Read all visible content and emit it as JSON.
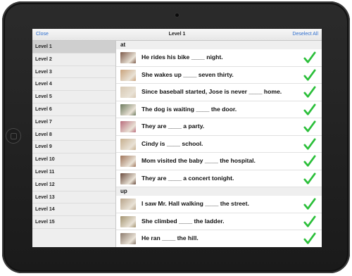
{
  "topbar": {
    "close_label": "Close",
    "title": "Level 1",
    "deselect_label": "Deselect All"
  },
  "sidebar": {
    "items": [
      {
        "label": "Level 1"
      },
      {
        "label": "Level 2"
      },
      {
        "label": "Level 3"
      },
      {
        "label": "Level 4"
      },
      {
        "label": "Level 5"
      },
      {
        "label": "Level 6"
      },
      {
        "label": "Level 7"
      },
      {
        "label": "Level 8"
      },
      {
        "label": "Level 9"
      },
      {
        "label": "Level 10"
      },
      {
        "label": "Level 11"
      },
      {
        "label": "Level 12"
      },
      {
        "label": "Level 13"
      },
      {
        "label": "Level 14"
      },
      {
        "label": "Level 15"
      }
    ],
    "active_index": 0
  },
  "sections": [
    {
      "header": "at",
      "rows": [
        {
          "text": "He rides his bike ____ night.",
          "checked": true
        },
        {
          "text": "She wakes up ____ seven thirty.",
          "checked": true
        },
        {
          "text": "Since baseball started, Jose is never ____ home.",
          "checked": true
        },
        {
          "text": "The dog is waiting ____ the door.",
          "checked": true
        },
        {
          "text": "They are ____ a party.",
          "checked": true
        },
        {
          "text": "Cindy is ____ school.",
          "checked": true
        },
        {
          "text": "Mom visited the baby ____ the hospital.",
          "checked": true
        },
        {
          "text": "They are ____ a concert tonight.",
          "checked": true
        }
      ]
    },
    {
      "header": "up",
      "rows": [
        {
          "text": "I saw Mr. Hall walking ____ the street.",
          "checked": true
        },
        {
          "text": "She climbed ____ the ladder.",
          "checked": true
        },
        {
          "text": "He ran ____ the hill.",
          "checked": true
        },
        {
          "text": "",
          "checked": true
        }
      ]
    }
  ],
  "colors": {
    "accent": "#2f6fcf",
    "check": "#2bbf3a"
  },
  "thumbnail_colors": [
    "#7d5a4a",
    "#c9a37c",
    "#d7c8b2",
    "#6c7b5e",
    "#b96c7c",
    "#c7b08f",
    "#a0765b",
    "#6b4d3f",
    "#b8a48a",
    "#a39371",
    "#8b7a6d",
    "#b7b0a5"
  ]
}
